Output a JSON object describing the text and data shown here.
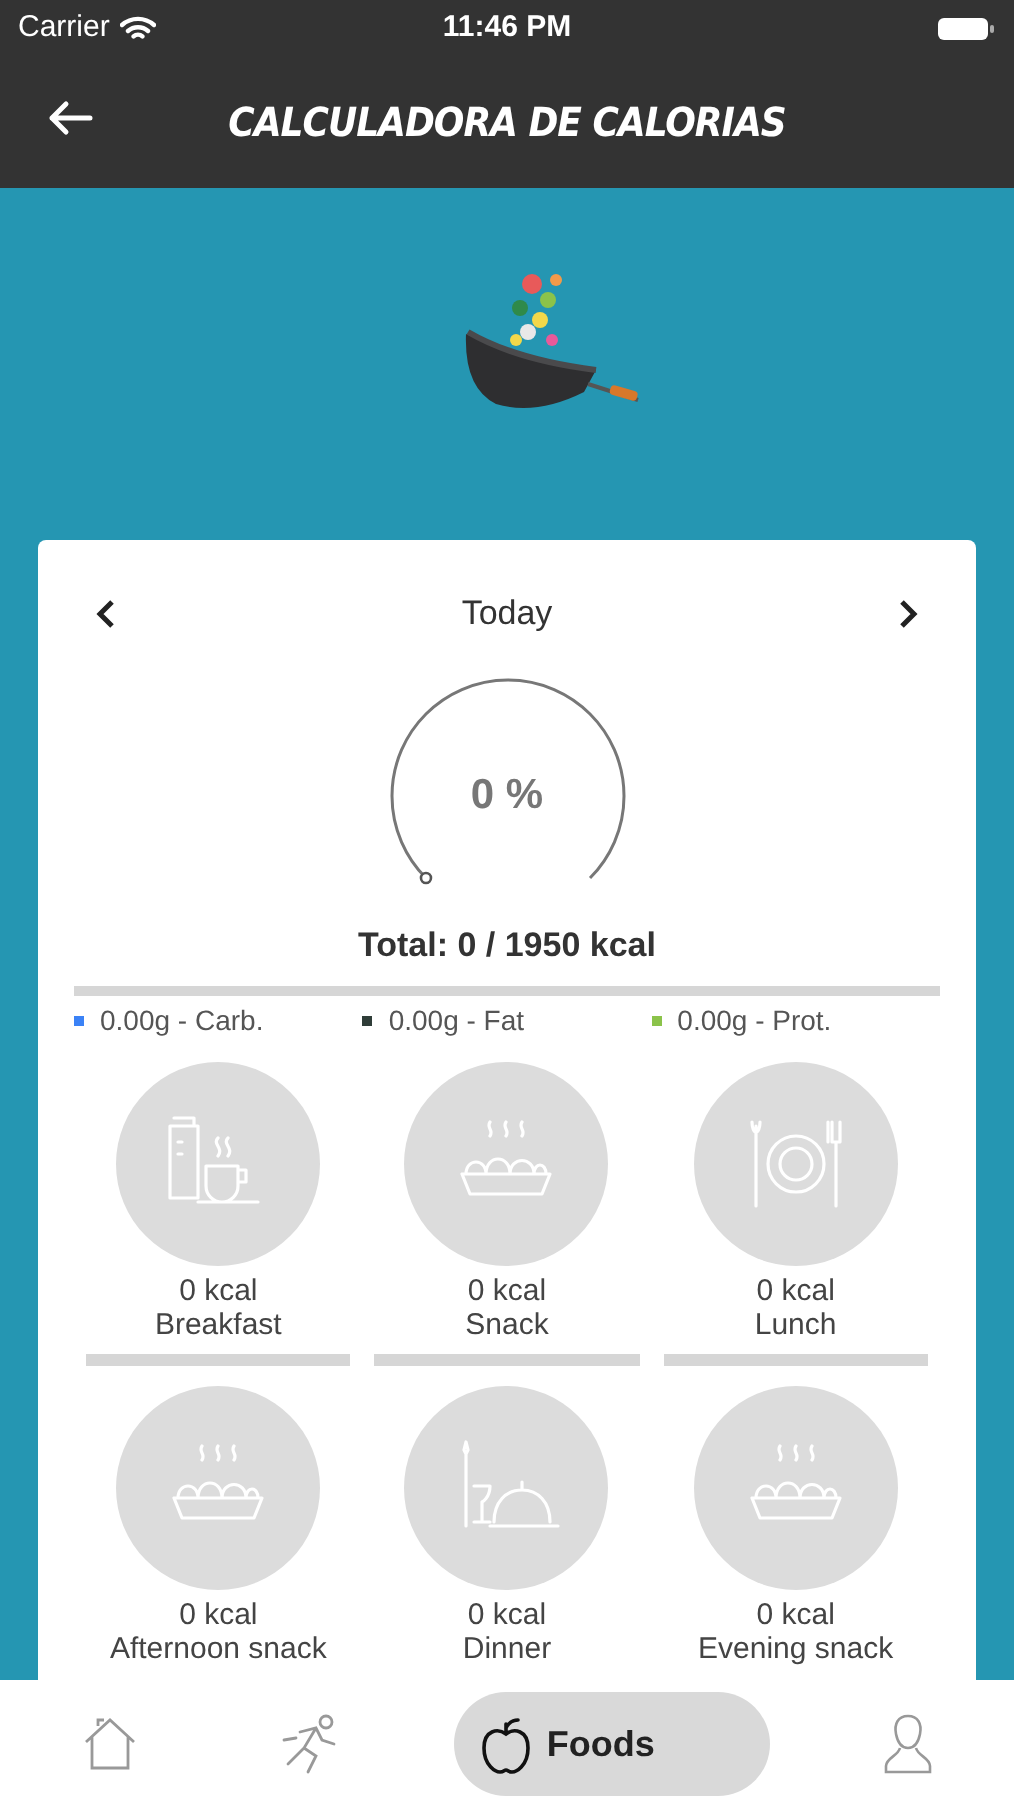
{
  "status_bar": {
    "carrier": "Carrier",
    "time": "11:46 PM"
  },
  "header": {
    "title": "CALCULADORA DE CALORIAS"
  },
  "day_nav": {
    "label": "Today"
  },
  "gauge": {
    "percent": "0 %"
  },
  "total": "Total: 0 / 1950 kcal",
  "macros": [
    {
      "text": "0.00g - Carb.",
      "color": "#3b82f6"
    },
    {
      "text": "0.00g - Fat",
      "color": "#2f3d38"
    },
    {
      "text": "0.00g - Prot.",
      "color": "#8bc34a"
    }
  ],
  "meals": [
    {
      "kcal": "0 kcal",
      "name": "Breakfast",
      "kind": "breakfast"
    },
    {
      "kcal": "0 kcal",
      "name": "Snack",
      "kind": "snack"
    },
    {
      "kcal": "0 kcal",
      "name": "Lunch",
      "kind": "lunch"
    },
    {
      "kcal": "0 kcal",
      "name": "Afternoon snack",
      "kind": "snack"
    },
    {
      "kcal": "0 kcal",
      "name": "Dinner",
      "kind": "dinner"
    },
    {
      "kcal": "0 kcal",
      "name": "Evening snack",
      "kind": "snack"
    }
  ],
  "tabs": [
    {
      "kind": "home",
      "selected": false
    },
    {
      "kind": "running",
      "selected": false
    },
    {
      "kind": "apple",
      "label": "Foods",
      "selected": true
    },
    {
      "kind": "person",
      "selected": false
    }
  ]
}
